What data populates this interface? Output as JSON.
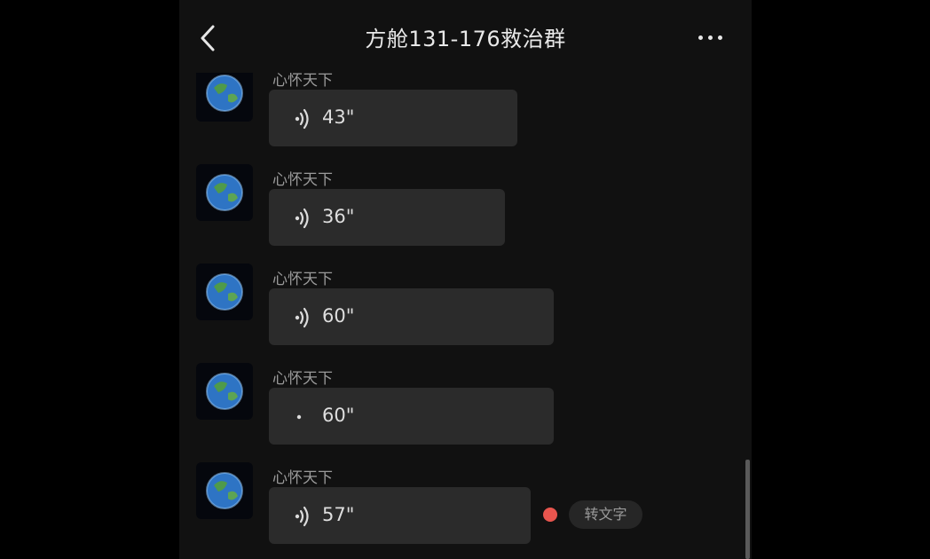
{
  "header": {
    "back_icon": "chevron-left-icon",
    "title": "方舱131-176救治群",
    "more_icon": "more-horizontal-icon"
  },
  "messages": [
    {
      "sender": "心怀天下",
      "duration": "43\"",
      "avatar_icon": "earth-avatar-icon"
    },
    {
      "sender": "心怀天下",
      "duration": "36\"",
      "avatar_icon": "earth-avatar-icon"
    },
    {
      "sender": "心怀天下",
      "duration": "60\"",
      "avatar_icon": "earth-avatar-icon"
    },
    {
      "sender": "心怀天下",
      "duration": "60\"",
      "avatar_icon": "earth-avatar-icon"
    },
    {
      "sender": "心怀天下",
      "duration": "57\"",
      "avatar_icon": "earth-avatar-icon",
      "unread": true
    }
  ],
  "convert_to_text_label": "转文字",
  "colors": {
    "background": "#111111",
    "bubble": "#2b2b2b",
    "unread_dot": "#e8554e"
  }
}
